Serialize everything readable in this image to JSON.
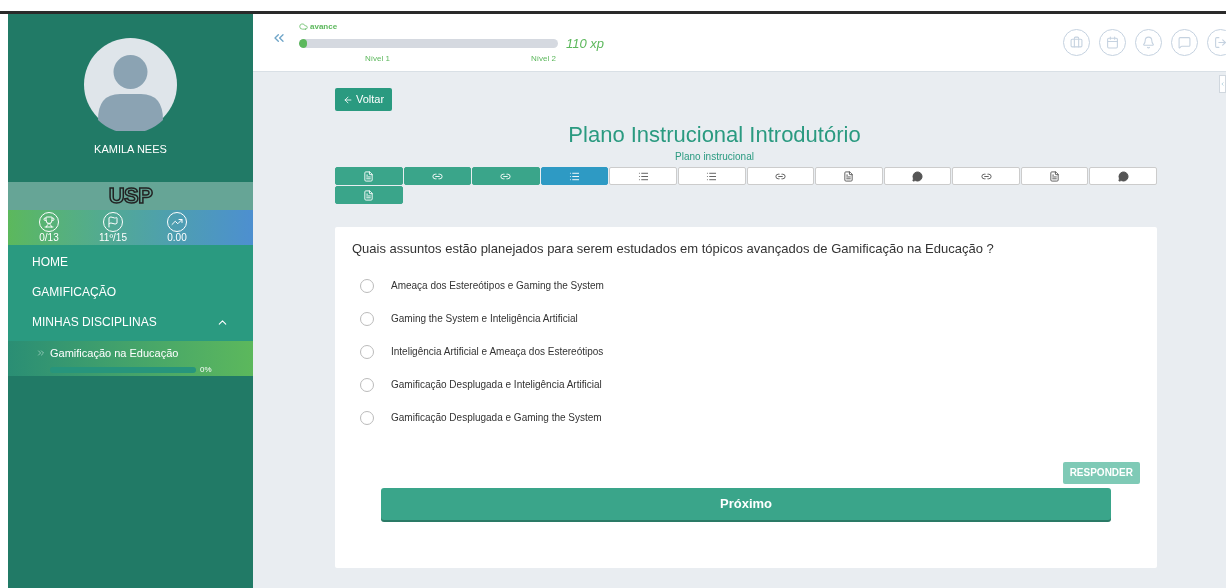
{
  "sidebar": {
    "user_name": "KAMILA NEES",
    "logo": "USP",
    "stats": [
      {
        "kind": "trophy",
        "value": "0/13"
      },
      {
        "kind": "flags",
        "value": "11º/15"
      },
      {
        "kind": "chart",
        "value": "0.00"
      }
    ],
    "menu": [
      {
        "label": "HOME",
        "kind": "link"
      },
      {
        "label": "GAMIFICAÇÃO",
        "kind": "link"
      },
      {
        "label": "MINHAS DISCIPLINAS",
        "kind": "group",
        "expanded": true
      }
    ],
    "courses": [
      {
        "label": "Gamificação na Educação",
        "level": 0,
        "percent": "0%",
        "selected": true
      }
    ]
  },
  "header": {
    "brand": "avance",
    "level": 0.03,
    "level_start": "Nível 1",
    "level_end": "Nível 2",
    "xp": "110 xp"
  },
  "back_button": "Voltar",
  "title": "Plano Instrucional Introdutório",
  "subtitle": "Plano instrucional",
  "steps": [
    {
      "kind": "pdf",
      "completed": true,
      "selected": false
    },
    {
      "kind": "link",
      "completed": true,
      "selected": false
    },
    {
      "kind": "link",
      "completed": true,
      "selected": false
    },
    {
      "kind": "list",
      "completed": false,
      "selected": true
    },
    {
      "kind": "list",
      "completed": false,
      "selected": false
    },
    {
      "kind": "list",
      "completed": false,
      "selected": false
    },
    {
      "kind": "link",
      "completed": false,
      "selected": false
    },
    {
      "kind": "pdf",
      "completed": false,
      "selected": false
    },
    {
      "kind": "chat",
      "completed": false,
      "selected": false
    },
    {
      "kind": "link",
      "completed": false,
      "selected": false
    },
    {
      "kind": "pdf",
      "completed": false,
      "selected": false
    },
    {
      "kind": "chat",
      "completed": false,
      "selected": false
    },
    {
      "kind": "pdf",
      "completed": true,
      "selected": false
    }
  ],
  "question": "Quais assuntos estão planejados para serem estudados em tópicos avançados de Gamificação na Educação ?",
  "options": [
    {
      "label": "Ameaça dos Estereótipos e Gaming the System",
      "selected": false
    },
    {
      "label": "Gaming the System e Inteligência Artificial",
      "selected": false
    },
    {
      "label": "Inteligência Artificial e Ameaça dos Estereótipos",
      "selected": false
    },
    {
      "label": "Gamificação Desplugada e Inteligência Artificial",
      "selected": false
    },
    {
      "label": "Gamificação Desplugada e Gaming the System",
      "selected": false
    }
  ],
  "answer_button": "RESPONDER",
  "next_button": "Próximo"
}
